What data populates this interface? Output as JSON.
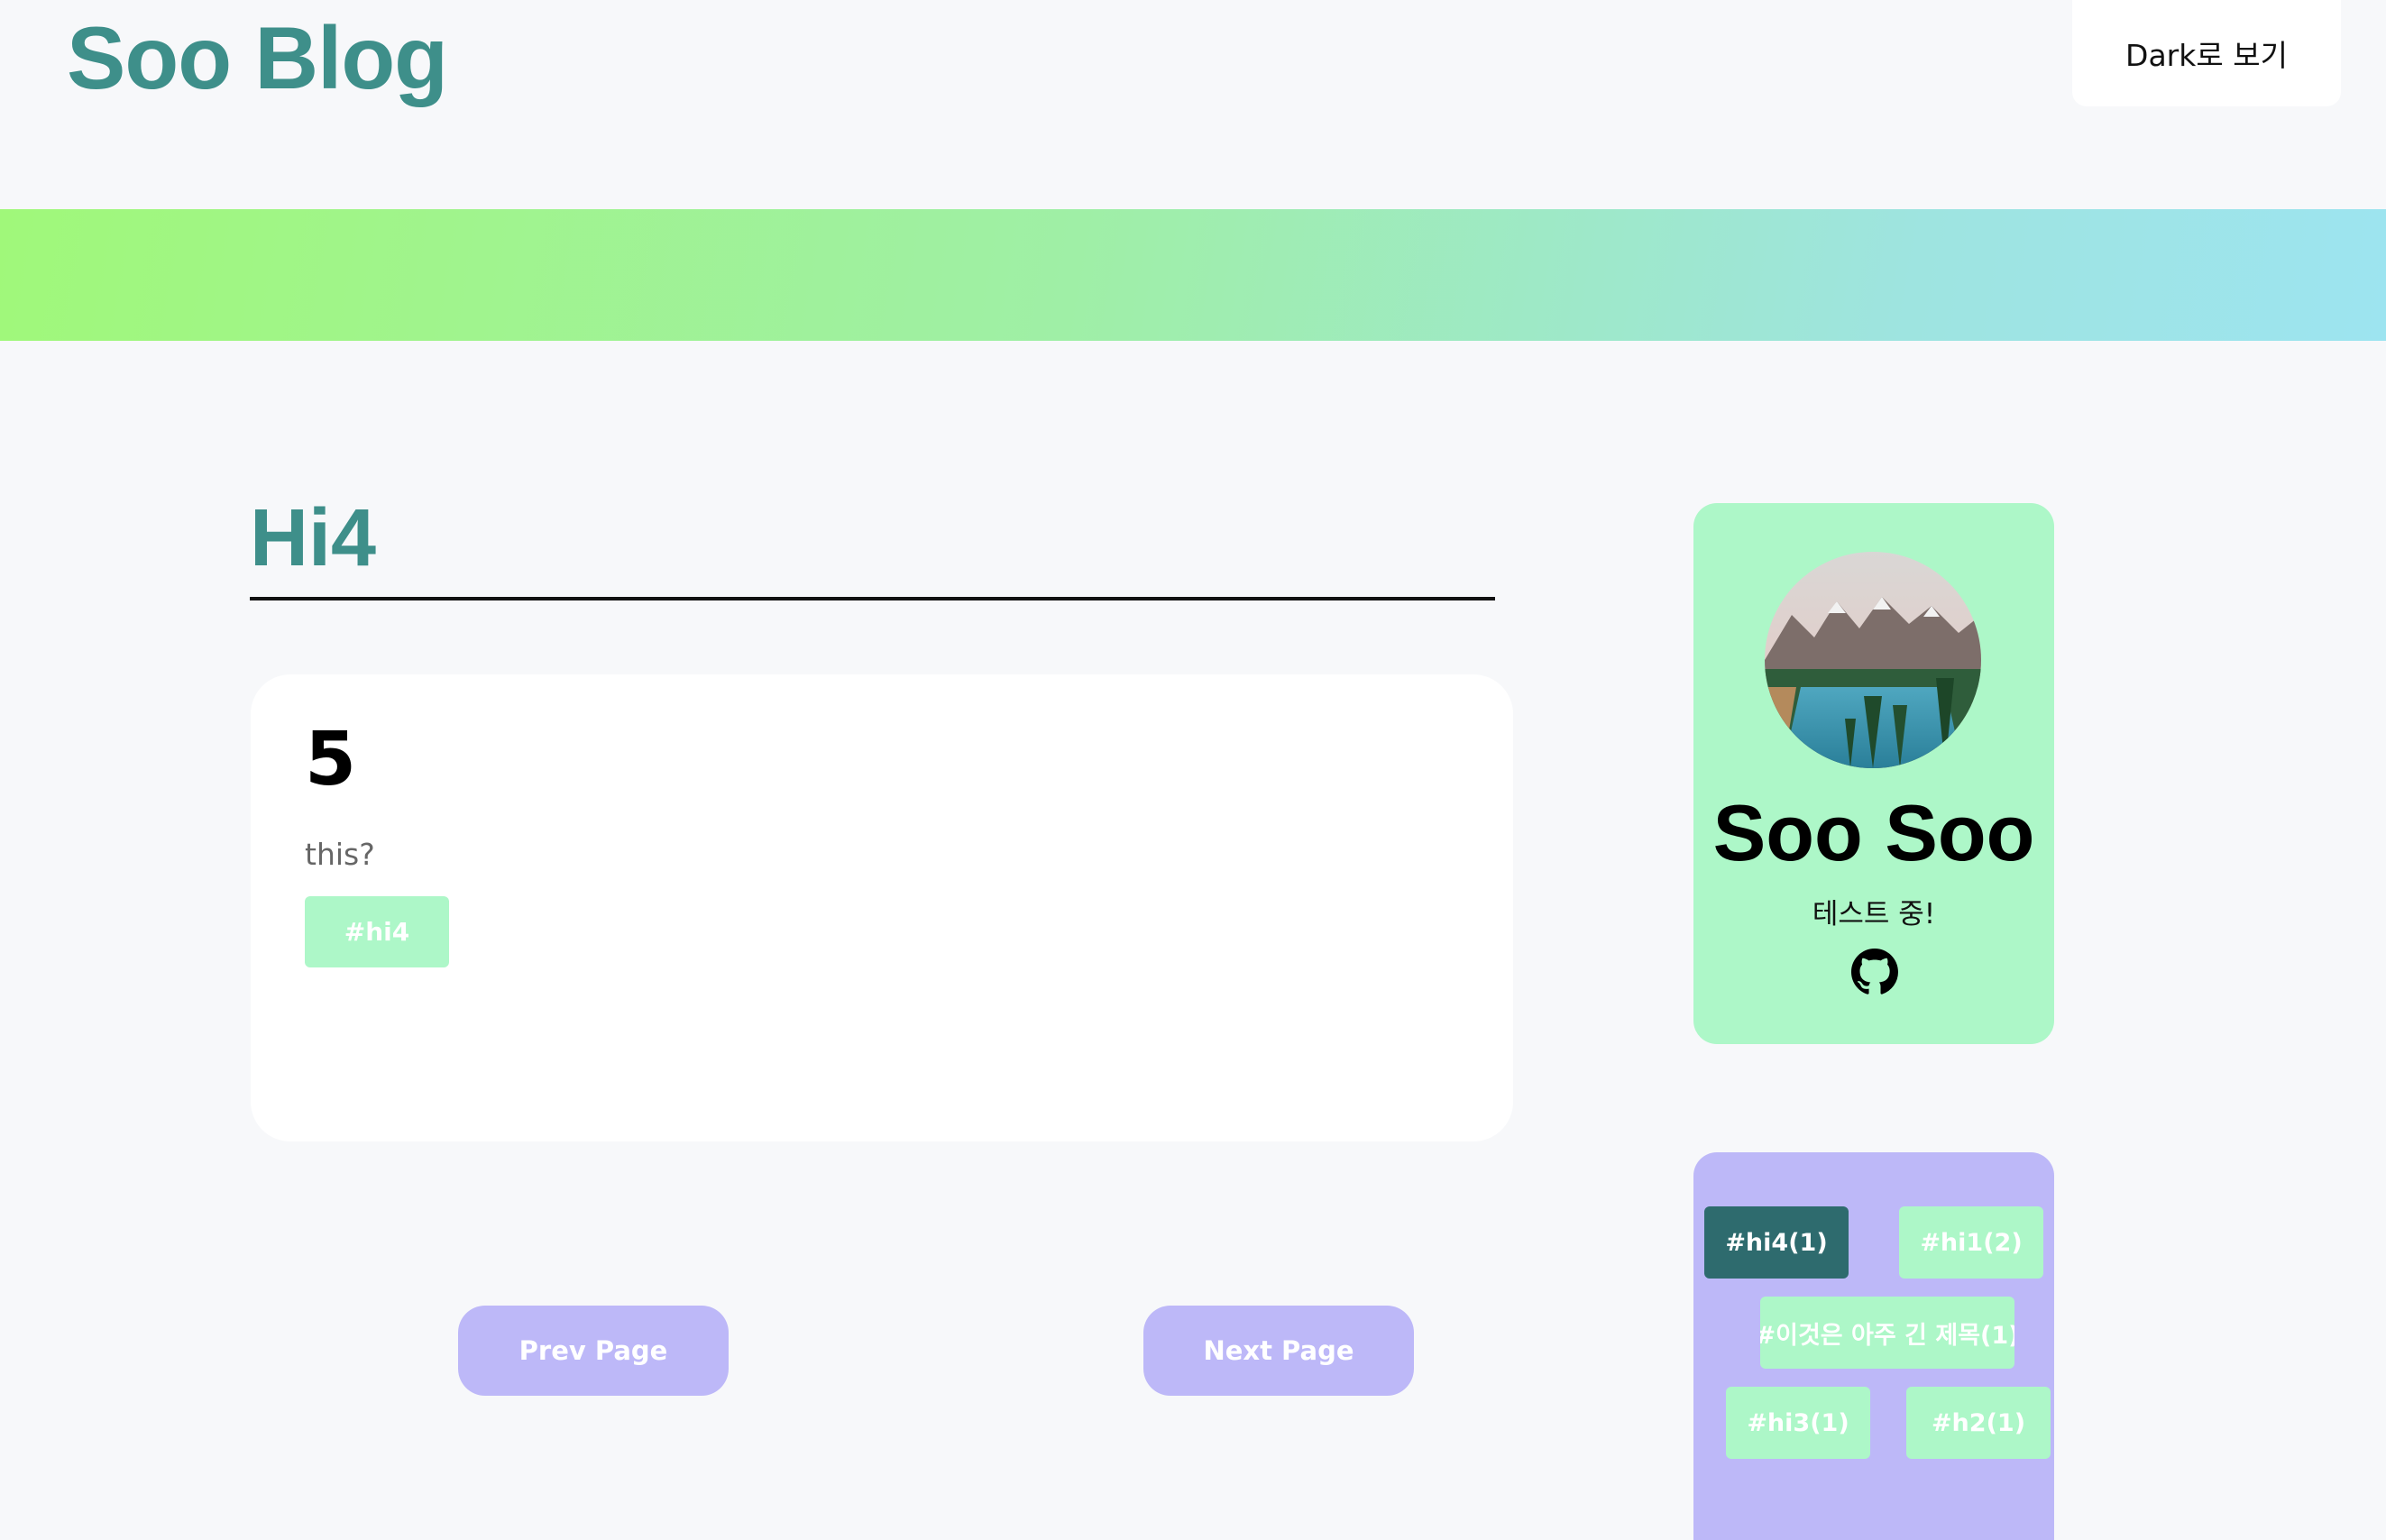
{
  "header": {
    "site_title": "Soo Blog",
    "theme_toggle_label": "Dark로 보기"
  },
  "colors": {
    "brand": "#3e8f8a",
    "banner_start": "#a0f87a",
    "banner_end": "#9de4f0",
    "tag_bg": "#adf7c8",
    "tag_active_bg": "#2e6b6e",
    "pager_bg": "#bdb8f8"
  },
  "main": {
    "category_title": "Hi4",
    "posts": [
      {
        "title": "5",
        "summary": "this?",
        "tags": [
          "#hi4"
        ]
      }
    ],
    "pager": {
      "prev_label": "Prev Page",
      "next_label": "Next Page"
    }
  },
  "sidebar": {
    "profile": {
      "avatar": "mountain-lake-photo",
      "name": "Soo Soo",
      "description": "테스트 중!",
      "link_icon": "github-icon"
    },
    "tags": [
      {
        "label": "#hi4(1)",
        "active": true
      },
      {
        "label": "#hi1(2)",
        "active": false
      },
      {
        "label": "#이것은 아주 긴 제목(1)",
        "active": false
      },
      {
        "label": "#hi3(1)",
        "active": false
      },
      {
        "label": "#h2(1)",
        "active": false
      }
    ]
  }
}
